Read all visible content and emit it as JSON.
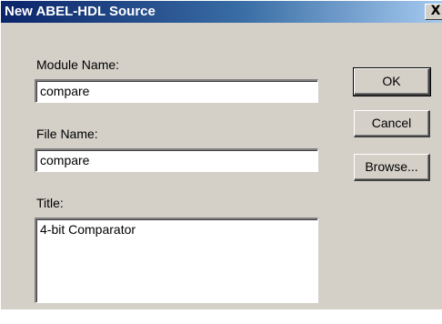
{
  "window": {
    "title": "New ABEL-HDL Source",
    "close_glyph": "X"
  },
  "form": {
    "module_name_label": "Module Name:",
    "module_name_value": "compare",
    "file_name_label": "File Name:",
    "file_name_value": "compare",
    "title_label": "Title:",
    "title_value": "4-bit Comparator"
  },
  "buttons": {
    "ok": "OK",
    "cancel": "Cancel",
    "browse": "Browse..."
  }
}
